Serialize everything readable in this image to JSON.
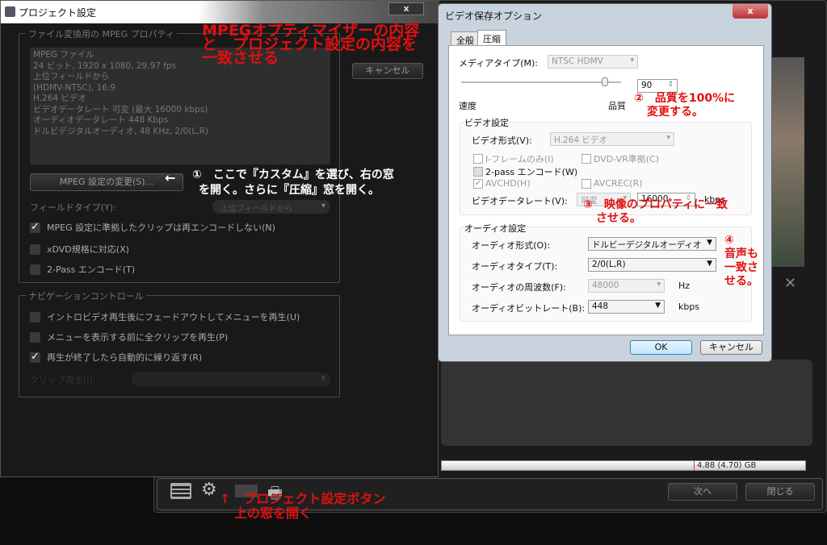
{
  "project_dialog": {
    "title": "プロジェクト設定",
    "close": "x",
    "mpeg_group_label": "ファイル変換用の MPEG プロパティ",
    "mpeg_info": [
      "MPEG ファイル",
      "24 ビット, 1920 x 1080, 29.97 fps",
      "上位フィールドから",
      "(HDMV-NTSC), 16:9",
      "H.264 ビデオ",
      "ビデオデータレート 可変 (最大 16000 kbps)",
      "オーディオデータレート 448 Kbps",
      "ドルビデジタルオーディオ, 48 KHz, 2/0(L,R)"
    ],
    "cancel": "キャンセル",
    "change_mpeg": "MPEG 設定の変更(S)...",
    "field_type_label": "フィールドタイプ(Y):",
    "field_type_value": "上位フィールドから",
    "checks": [
      {
        "label": "MPEG 設定に準拠したクリップは再エンコードしない(N)",
        "checked": true
      },
      {
        "label": "xDVD規格に対応(X)",
        "checked": false
      },
      {
        "label": "2-Pass エンコード(T)",
        "checked": false
      }
    ],
    "nav_group_label": "ナビゲーションコントロール",
    "nav_checks": [
      {
        "label": "イントロビデオ再生後にフェードアウトしてメニューを再生(U)",
        "checked": false
      },
      {
        "label": "メニューを表示する前に全クリップを再生(P)",
        "checked": false
      },
      {
        "label": "再生が終了したら自動的に繰り返す(R)",
        "checked": true
      }
    ],
    "clip_play_label": "クリップ再生(I):"
  },
  "video_dialog": {
    "title": "ビデオ保存オプション",
    "close": "x",
    "tabs": [
      "全般",
      "圧縮"
    ],
    "media_type_label": "メディアタイプ(M):",
    "media_type_value": "NTSC HDMV",
    "quality_value": "90",
    "quality_fraction": 0.9,
    "speed_label": "速度",
    "quality_label": "品質",
    "video_group": "ビデオ設定",
    "video_format_label": "ビデオ形式(V):",
    "video_format_value": "H.264 ビデオ",
    "iframe": "I-フレームのみ(I)",
    "dvdvr": "DVD-VR準拠(C)",
    "twopass": "2-pass エンコード(W)",
    "avchd": "AVCHD(H)",
    "avcrec": "AVCREC(R)",
    "check_mark": "✓",
    "bitrate_label": "ビデオデータレート(V):",
    "bitrate_mode": "可変",
    "bitrate_value": "16000",
    "kbps": "kbps",
    "audio_group": "オーディオ設定",
    "audio_format_label": "オーディオ形式(O):",
    "audio_format_value": "ドルビーデジタルオーディオ",
    "audio_type_label": "オーディオタイプ(T):",
    "audio_type_value": "2/0(L,R)",
    "audio_freq_label": "オーディオの周波数(F):",
    "audio_freq_value": "48000",
    "hz": "Hz",
    "audio_bitrate_label": "オーディオビットレート(B):",
    "audio_bitrate_value": "448",
    "ok": "OK",
    "cancel": "キャンセル"
  },
  "app": {
    "disc_usage": "4.88 (4.70) GB",
    "next": "次へ",
    "close": "閉じる"
  },
  "annotations": {
    "top": [
      "MPEGオプティマイザーの内容",
      "と　プロジェクト設定の内容を",
      "一致させる"
    ],
    "step1": [
      "①　ここで『カスタム』を選び、右の窓",
      "を開く。さらに『圧縮』窓を開く。"
    ],
    "step2": [
      "②　品質を100%に",
      "変更する。"
    ],
    "step3": [
      "③　映像のプロパティに一致",
      "させる。"
    ],
    "step4": [
      "④",
      "音声も",
      "一致さ",
      "せる。"
    ],
    "bottom": [
      "↑　プロジェクト設定ボタン",
      "上の窓を開く"
    ],
    "arrow": "←"
  }
}
